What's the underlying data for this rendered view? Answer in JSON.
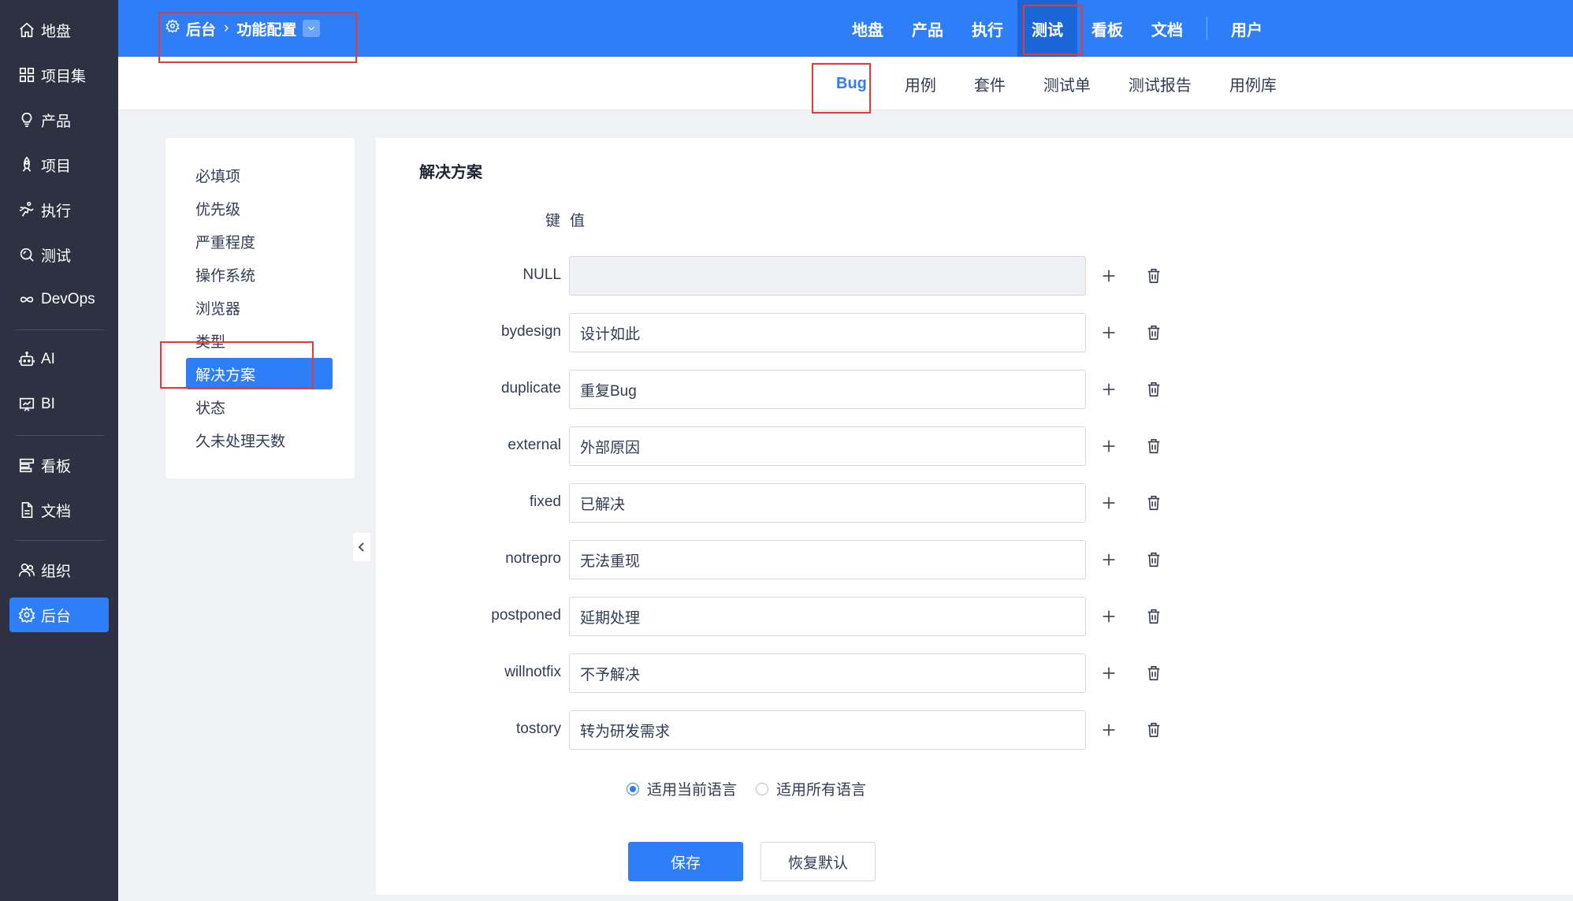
{
  "leftnav": {
    "items": [
      {
        "label": "地盘",
        "icon": "home-icon"
      },
      {
        "label": "项目集",
        "icon": "grid-icon"
      },
      {
        "label": "产品",
        "icon": "bulb-icon"
      },
      {
        "label": "项目",
        "icon": "rocket-icon"
      },
      {
        "label": "执行",
        "icon": "run-icon"
      },
      {
        "label": "测试",
        "icon": "test-search-icon"
      },
      {
        "label": "DevOps",
        "icon": "infinity-icon"
      },
      {
        "label": "AI",
        "icon": "robot-icon"
      },
      {
        "label": "BI",
        "icon": "chart-board-icon"
      },
      {
        "label": "看板",
        "icon": "kanban-icon"
      },
      {
        "label": "文档",
        "icon": "document-icon"
      },
      {
        "label": "组织",
        "icon": "users-icon"
      },
      {
        "label": "后台",
        "icon": "gear-icon"
      }
    ],
    "active": "后台"
  },
  "header": {
    "breadcrumb_root": "后台",
    "breadcrumb_current": "功能配置",
    "main_nav": [
      "地盘",
      "产品",
      "执行",
      "测试",
      "看板",
      "文档"
    ],
    "main_nav_extra": "用户",
    "main_nav_active": "测试"
  },
  "subnav": {
    "items": [
      "Bug",
      "用例",
      "套件",
      "测试单",
      "测试报告",
      "用例库"
    ],
    "active": "Bug"
  },
  "config_menu": {
    "items": [
      "必填项",
      "优先级",
      "严重程度",
      "操作系统",
      "浏览器",
      "类型",
      "解决方案",
      "状态",
      "久未处理天数"
    ],
    "active": "解决方案"
  },
  "content": {
    "title": "解决方案",
    "key_header": "键",
    "value_header": "值",
    "rows": [
      {
        "key": "NULL",
        "value": "",
        "disabled": true
      },
      {
        "key": "bydesign",
        "value": "设计如此"
      },
      {
        "key": "duplicate",
        "value": "重复Bug"
      },
      {
        "key": "external",
        "value": "外部原因"
      },
      {
        "key": "fixed",
        "value": "已解决"
      },
      {
        "key": "notrepro",
        "value": "无法重现"
      },
      {
        "key": "postponed",
        "value": "延期处理"
      },
      {
        "key": "willnotfix",
        "value": "不予解决"
      },
      {
        "key": "tostory",
        "value": "转为研发需求"
      }
    ],
    "lang_options": [
      "适用当前语言",
      "适用所有语言"
    ],
    "lang_selected": "适用当前语言",
    "save_label": "保存",
    "reset_label": "恢复默认"
  },
  "colors": {
    "accent": "#2e7ff7",
    "nav_bg": "#2d3142",
    "highlight_box": "#e53935"
  }
}
